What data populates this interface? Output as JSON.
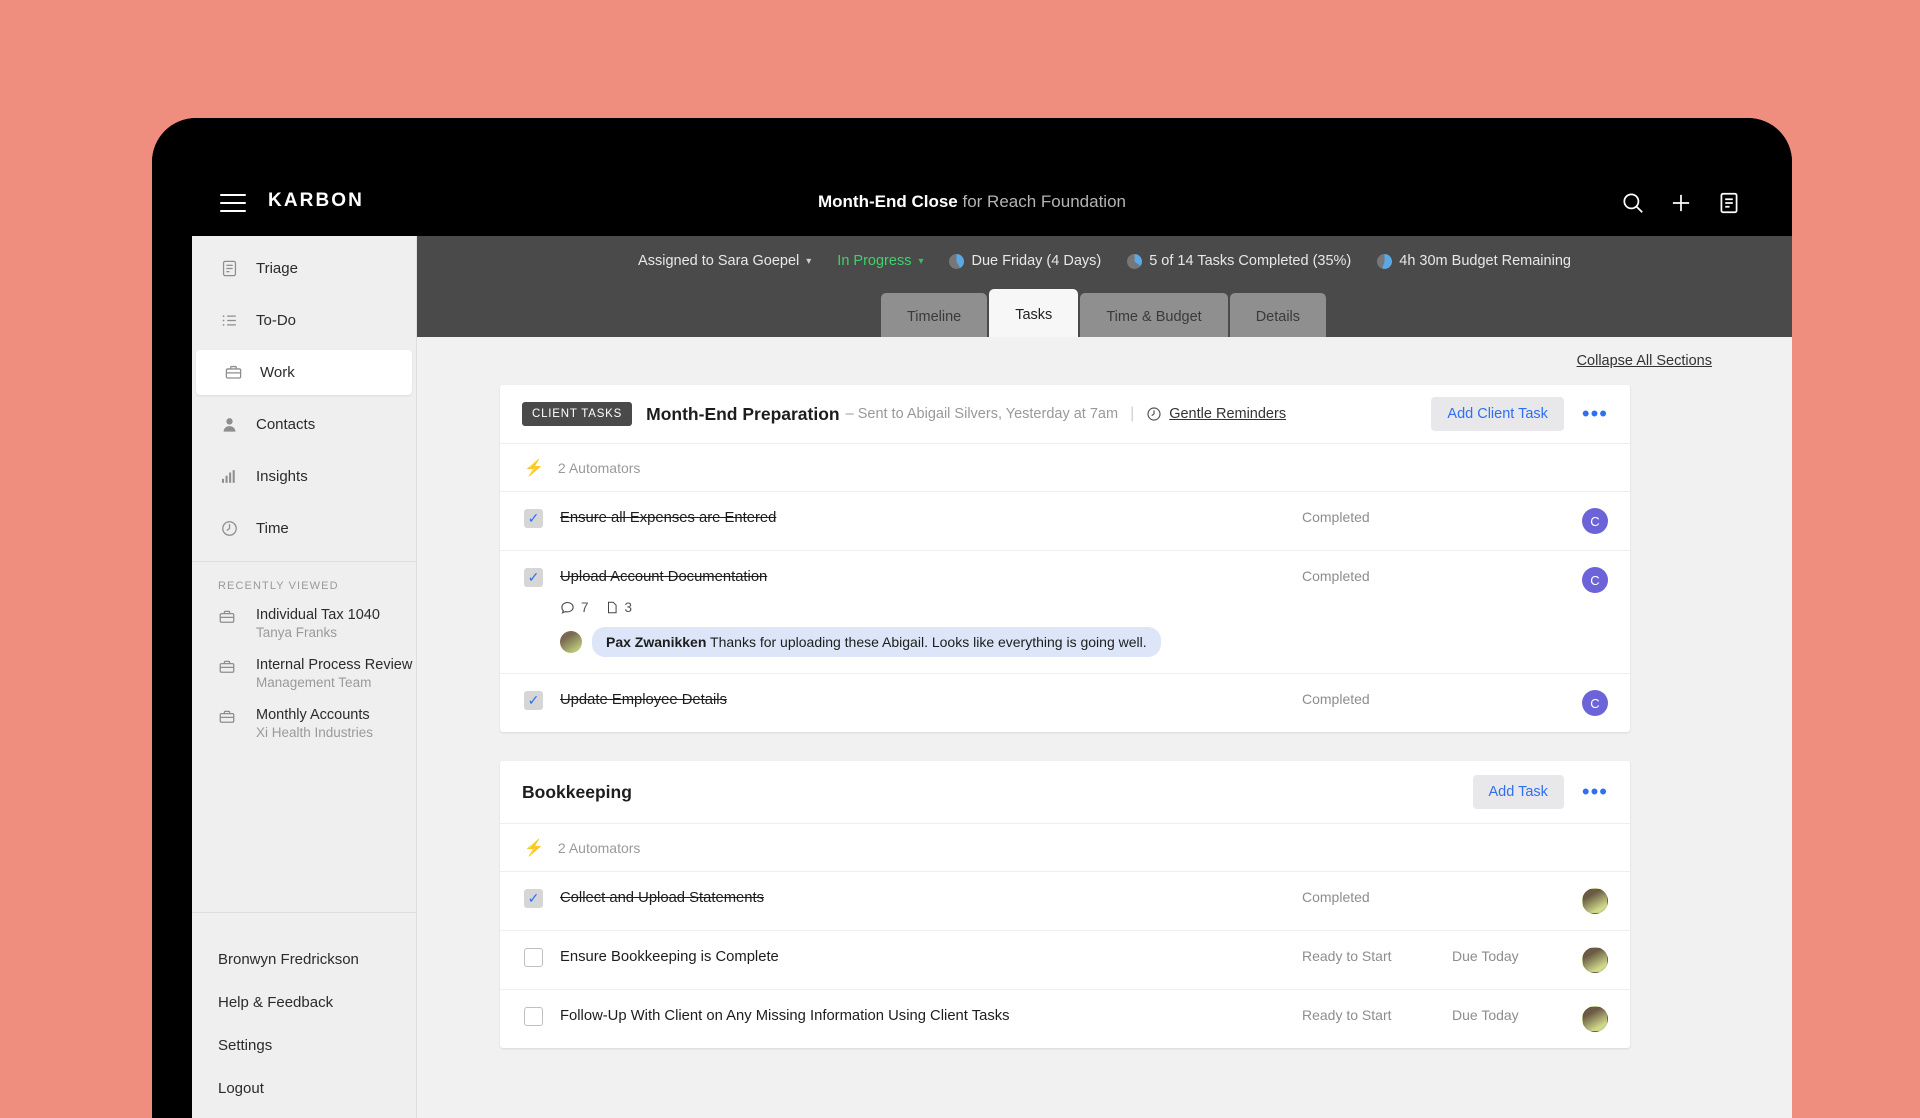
{
  "app": {
    "brand": "KARBON",
    "menu_icon": "hamburger-icon",
    "title_bold": "Month-End Close",
    "title_rest": " for Reach Foundation",
    "top_icons": [
      "search-icon",
      "plus-icon",
      "note-icon"
    ]
  },
  "sidebar": {
    "items": [
      {
        "label": "Triage",
        "icon": "triage-icon",
        "active": false
      },
      {
        "label": "To-Do",
        "icon": "list-icon",
        "active": false
      },
      {
        "label": "Work",
        "icon": "briefcase-icon",
        "active": true
      },
      {
        "label": "Contacts",
        "icon": "person-icon",
        "active": false
      },
      {
        "label": "Insights",
        "icon": "bar-chart-icon",
        "active": false
      },
      {
        "label": "Time",
        "icon": "clock-icon",
        "active": false
      }
    ],
    "recently_viewed_label": "RECENTLY VIEWED",
    "recently_viewed": [
      {
        "name": "Individual Tax 1040",
        "sub": "Tanya Franks"
      },
      {
        "name": "Internal Process Review",
        "sub": "Management Team"
      },
      {
        "name": "Monthly Accounts",
        "sub": "Xi Health Industries"
      }
    ],
    "bottom": [
      {
        "label": "Bronwyn Fredrickson"
      },
      {
        "label": "Help & Feedback"
      },
      {
        "label": "Settings"
      },
      {
        "label": "Logout"
      }
    ]
  },
  "work_header": {
    "assigned": "Assigned to Sara Goepel",
    "status": "In Progress",
    "status_color": "#3fd16b",
    "due": "Due Friday (4 Days)",
    "tasks_completed": "5 of 14 Tasks Completed (35%)",
    "budget": "4h 30m Budget Remaining",
    "tabs": [
      {
        "label": "Timeline",
        "active": false
      },
      {
        "label": "Tasks",
        "active": true
      },
      {
        "label": "Time & Budget",
        "active": false
      },
      {
        "label": "Details",
        "active": false
      }
    ]
  },
  "content": {
    "collapse_all": "Collapse All Sections",
    "sections": [
      {
        "badge": "CLIENT TASKS",
        "title": "Month-End Preparation",
        "subtitle": "– Sent to Abigail Silvers, Yesterday at 7am",
        "gentle_reminders": "Gentle Reminders",
        "add_button": "Add Client Task",
        "automators": "2 Automators",
        "tasks": [
          {
            "name": "Ensure all Expenses are Entered",
            "done": true,
            "status": "Completed",
            "due": "",
            "avatar": "C",
            "avatar_type": "initial"
          },
          {
            "name": "Upload Account Documentation",
            "done": true,
            "status": "Completed",
            "due": "",
            "avatar": "C",
            "avatar_type": "initial",
            "comment_count": "7",
            "doc_count": "3",
            "comment_author": "Pax Zwanikken",
            "comment_text": "Thanks for uploading these Abigail. Looks like everything is going well."
          },
          {
            "name": "Update Employee Details",
            "done": true,
            "status": "Completed",
            "due": "",
            "avatar": "C",
            "avatar_type": "initial"
          }
        ]
      },
      {
        "badge": "",
        "title": "Bookkeeping",
        "subtitle": "",
        "gentle_reminders": "",
        "add_button": "Add Task",
        "automators": "2 Automators",
        "tasks": [
          {
            "name": "Collect and Upload Statements",
            "done": true,
            "status": "Completed",
            "due": "",
            "avatar": "",
            "avatar_type": "photo"
          },
          {
            "name": "Ensure Bookkeeping is Complete",
            "done": false,
            "status": "Ready to Start",
            "due": "Due Today",
            "avatar": "",
            "avatar_type": "photo"
          },
          {
            "name": "Follow-Up With Client on Any Missing Information Using Client Tasks",
            "done": false,
            "status": "Ready to Start",
            "due": "Due Today",
            "avatar": "",
            "avatar_type": "photo"
          }
        ]
      }
    ]
  },
  "colors": {
    "accent_blue": "#2f6ff0",
    "avatar_purple": "#6c63d8",
    "status_green": "#3fd16b",
    "background": "#ef8d7f",
    "header_dark": "#4a4a4a"
  }
}
